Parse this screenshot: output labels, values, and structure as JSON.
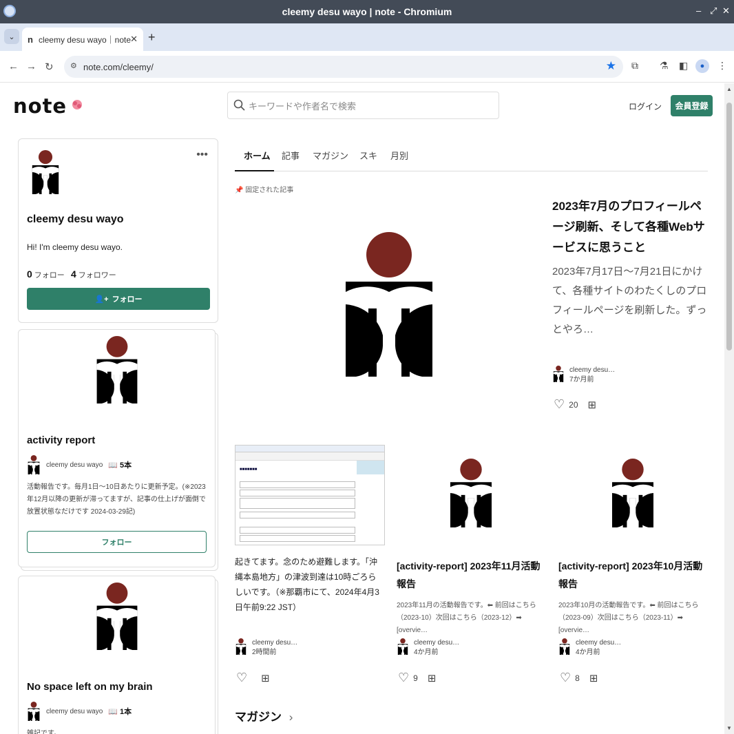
{
  "window": {
    "title": "cleemy desu wayo | note - Chromium"
  },
  "browser": {
    "tab_title": "cleemy desu wayo｜note",
    "tab_favicon": "n",
    "url": "note.com/cleemy/"
  },
  "header": {
    "logo": "note",
    "search_placeholder": "キーワードや作者名で検索",
    "login": "ログイン",
    "signup": "会員登録"
  },
  "profile": {
    "name": "cleemy desu wayo",
    "bio": "Hi! I'm cleemy desu wayo.",
    "following_count": "0",
    "following_label": "フォロー",
    "followers_count": "4",
    "followers_label": "フォロワー",
    "follow_button": "フォロー"
  },
  "magazines": [
    {
      "title": "activity report",
      "author": "cleemy desu wayo",
      "count": "5本",
      "description": "活動報告です。毎月1日〜10日あたりに更新予定。(※2023年12月以降の更新が滞ってますが、記事の仕上げが面倒で放置状態なだけです 2024-03-29記)",
      "follow_button": "フォロー"
    },
    {
      "title": "No space left on my brain",
      "author": "cleemy desu wayo",
      "count": "1本",
      "description": "雑記です。"
    }
  ],
  "tabs": [
    "ホーム",
    "記事",
    "マガジン",
    "スキ",
    "月別"
  ],
  "pinned": {
    "label": "固定された記事",
    "title": "2023年7月のプロフィールページ刷新、そして各種Webサービスに思うこと",
    "excerpt": "2023年7月17日〜7月21日にかけて、各種サイトのわたくしのプロフィールページを刷新した。ずっとやろ…",
    "author": "cleemy desu…",
    "time": "7か月前",
    "likes": "20"
  },
  "notes": [
    {
      "body": "起きてます。念のため避難します。「沖縄本島地方」の津波到達は10時ごろらしいです。（※那覇市にて、2024年4月3日午前9:22 JST）",
      "author": "cleemy desu…",
      "time": "2時間前",
      "likes": ""
    },
    {
      "title": "[activity-report] 2023年11月活動報告",
      "excerpt": "2023年11月の活動報告です。⬅ 前回はこちら（2023-10）次回はこちら（2023-12）➡ [overvie…",
      "author": "cleemy desu…",
      "time": "4か月前",
      "likes": "9"
    },
    {
      "title": "[activity-report] 2023年10月活動報告",
      "excerpt": "2023年10月の活動報告です。⬅ 前回はこちら（2023-09）次回はこちら（2023-11）➡ [overvie…",
      "author": "cleemy desu…",
      "time": "4か月前",
      "likes": "8"
    }
  ],
  "magazine_section": {
    "heading": "マガジン"
  },
  "colors": {
    "accent": "#2f8069",
    "logo_head": "#7a2620",
    "title_bar": "#434b57"
  }
}
